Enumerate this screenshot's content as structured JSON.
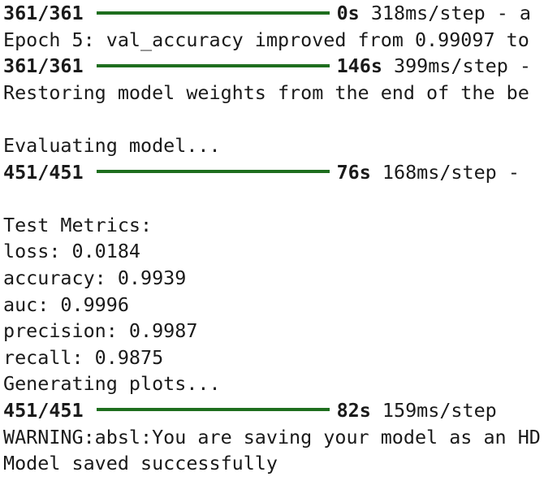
{
  "terminal": {
    "lines": [
      {
        "kind": "progress",
        "count": "361/361",
        "time": "0s",
        "rest": " 318ms/step - a"
      },
      {
        "kind": "text",
        "text": "Epoch 5: val_accuracy improved from 0.99097 to"
      },
      {
        "kind": "progress",
        "count": "361/361",
        "time": "146s",
        "rest": " 399ms/step -"
      },
      {
        "kind": "text",
        "text": "Restoring model weights from the end of the be"
      },
      {
        "kind": "empty"
      },
      {
        "kind": "text",
        "text": "Evaluating model..."
      },
      {
        "kind": "progress",
        "count": "451/451",
        "time": "76s",
        "rest": " 168ms/step - "
      },
      {
        "kind": "empty"
      },
      {
        "kind": "text",
        "text": "Test Metrics:"
      },
      {
        "kind": "text",
        "text": "loss: 0.0184"
      },
      {
        "kind": "text",
        "text": "accuracy: 0.9939"
      },
      {
        "kind": "text",
        "text": "auc: 0.9996"
      },
      {
        "kind": "text",
        "text": "precision: 0.9987"
      },
      {
        "kind": "text",
        "text": "recall: 0.9875"
      },
      {
        "kind": "text",
        "text": "Generating plots..."
      },
      {
        "kind": "progress",
        "count": "451/451",
        "time": "82s",
        "rest": " 159ms/step"
      },
      {
        "kind": "text",
        "text": "WARNING:absl:You are saving your model as an HD"
      },
      {
        "kind": "text",
        "text": "Model saved successfully"
      }
    ],
    "progress_bar_color": "#1e6e1e",
    "progress_fill": 1.0
  }
}
